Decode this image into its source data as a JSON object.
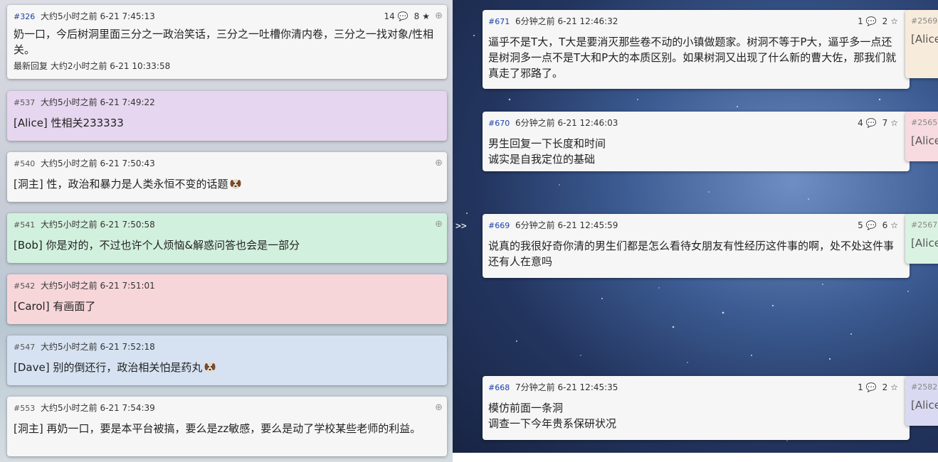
{
  "left": {
    "posts": [
      {
        "id": "#326",
        "time": "大约5小时之前 6-21 7:45:13",
        "comments": "14",
        "stars": "8",
        "text": "奶一口，今后树洞里面三分之一政治笑话，三分之一吐槽你清内卷，三分之一找对象/性相关。",
        "reply": "最新回复 大约2小时之前 6-21 10:33:58",
        "color": "#f6f6f6"
      },
      {
        "id": "#537",
        "time": "大约5小时之前 6-21 7:49:22",
        "text": "[Alice] 性相关233333",
        "color": "#e6d6ef"
      },
      {
        "id": "#540",
        "time": "大约5小时之前 6-21 7:50:43",
        "text": "[洞主] 性，政治和暴力是人类永恒不变的话题",
        "color": "#f6f6f6"
      },
      {
        "id": "#541",
        "time": "大约5小时之前 6-21 7:50:58",
        "text": "[Bob] 你是对的，不过也许个人烦恼&解惑问答也会是一部分",
        "color": "#d2f0de"
      },
      {
        "id": "#542",
        "time": "大约5小时之前 6-21 7:51:01",
        "text": "[Carol] 有画面了",
        "color": "#f7d6da"
      },
      {
        "id": "#547",
        "time": "大约5小时之前 6-21 7:52:18",
        "text": "[Dave] 别的倒还行，政治相关怕是药丸",
        "color": "#d6e2f2"
      },
      {
        "id": "#553",
        "time": "大约5小时之前 6-21 7:54:39",
        "text": "[洞主] 再奶一口，要是本平台被搞，要么是zz敏感，要么是动了学校某些老师的利益。",
        "color": "#f6f6f6"
      }
    ]
  },
  "right": {
    "collapse_label": ">>",
    "posts": [
      {
        "id": "#671",
        "time": "6分钟之前 6-21 12:46:32",
        "comments": "1",
        "stars": "2",
        "text": "逼乎不是T大，T大是要消灭那些卷不动的小镇做题家。树洞不等于P大，逼乎多一点还是树洞多一点不是T大和P大的本质区别。如果树洞又出现了什么新的曹大佐，那我们就真走了邪路了。"
      },
      {
        "id": "#670",
        "time": "6分钟之前 6-21 12:46:03",
        "comments": "4",
        "stars": "7",
        "text": "男生回复一下长度和时间\n诚实是自我定位的基础"
      },
      {
        "id": "#669",
        "time": "6分钟之前 6-21 12:45:59",
        "comments": "5",
        "stars": "6",
        "text": "说真的我很好奇你清的男生们都是怎么看待女朋友有性经历这件事的啊，处不处这件事还有人在意吗"
      },
      {
        "id": "#668",
        "time": "7分钟之前 6-21 12:45:35",
        "comments": "1",
        "stars": "2",
        "text": "模仿前面一条洞\n调查一下今年贵系保研状况"
      }
    ],
    "peeks": [
      {
        "id": "#2569",
        "text": "[Alice",
        "color": "#f7ebdc"
      },
      {
        "id": "#2565",
        "text": "[Alice",
        "color": "#f7dbe0"
      },
      {
        "id": "#2567",
        "text": "[Alice",
        "color": "#daf2e2"
      },
      {
        "id": "#2582",
        "text": "[Alice",
        "color": "#d9daf2"
      }
    ]
  }
}
